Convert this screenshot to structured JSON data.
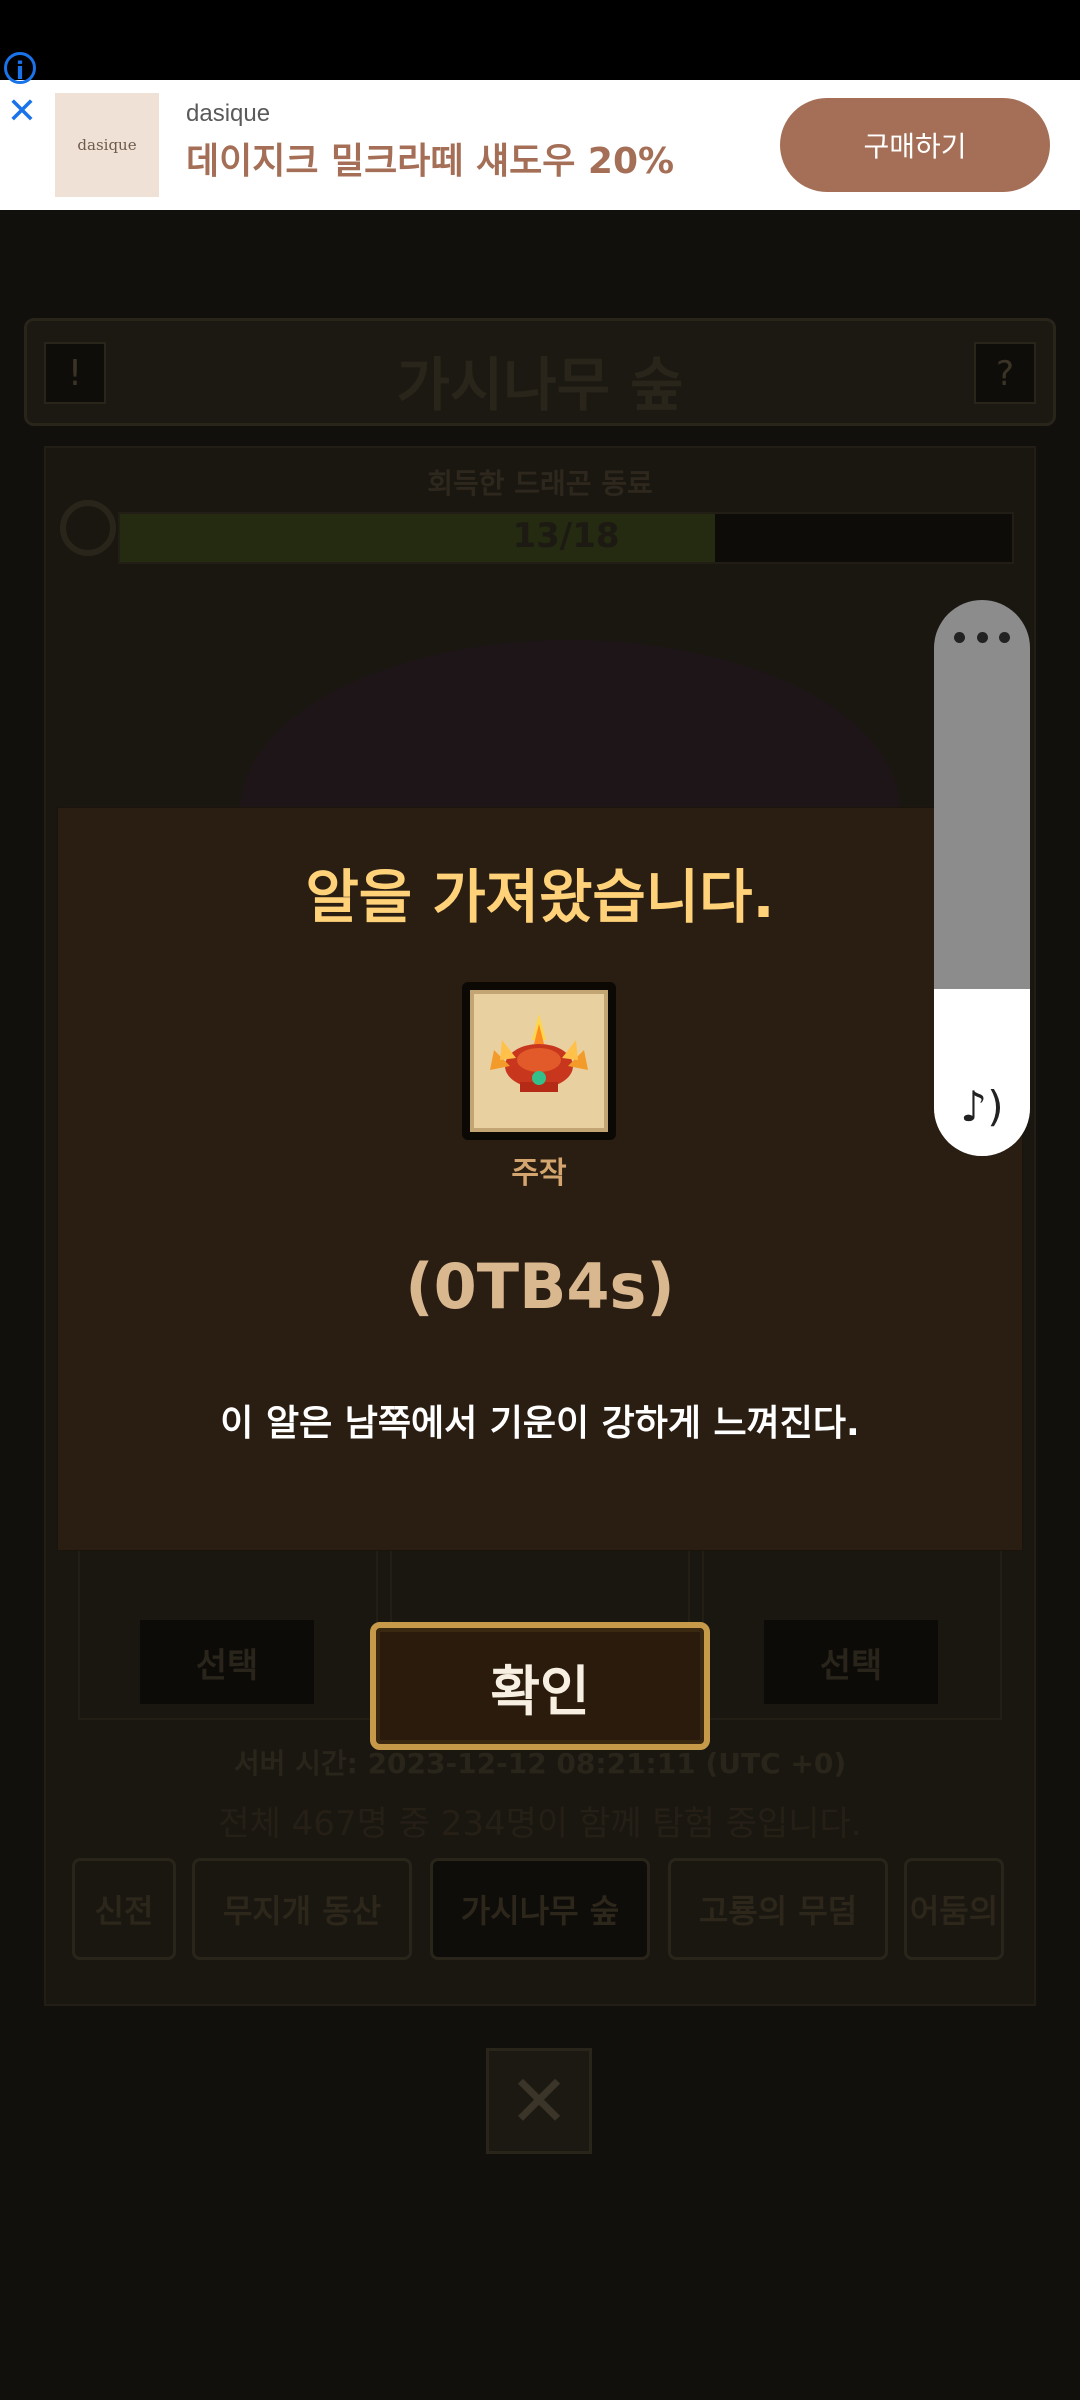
{
  "ad": {
    "brand": "dasique",
    "thumb_text": "dasique",
    "headline": "데이지크 밀크라떼 섀도우 20%",
    "cta": "구매하기"
  },
  "game": {
    "area_title": "가시나무 숲",
    "dragon_caption": "회득한 드래곤 동료",
    "progress_text": "13/18",
    "progress_fraction": 0.6667,
    "select_label": "선택",
    "server_time": "서버 시간: 2023-12-12 08:21:11 (UTC +0)",
    "participants": "전체 467명 중 234명이 함께 탐험 중입니다.",
    "tabs": [
      "신전",
      "무지개 동산",
      "가시나무 숲",
      "고룡의 무덤",
      "어둠의"
    ],
    "active_tab": "가시나무 숲"
  },
  "modal": {
    "title": "알을 가져왔습니다.",
    "egg_label": "주작",
    "egg_code": "(0TB4s)",
    "hint": "이 알은 남쪽에서 기운이 강하게 느껴진다.",
    "confirm": "확인"
  },
  "volume": {
    "level": 0.3
  },
  "colors": {
    "title_gold": "#ffd27a",
    "ad_accent": "#a46f56",
    "confirm_border": "#c79a4a"
  },
  "icons": {
    "info": "info-icon",
    "close_ad": "close-icon",
    "more": "more-icon",
    "sound": "music-note-icon",
    "close_game": "close-x-icon"
  }
}
